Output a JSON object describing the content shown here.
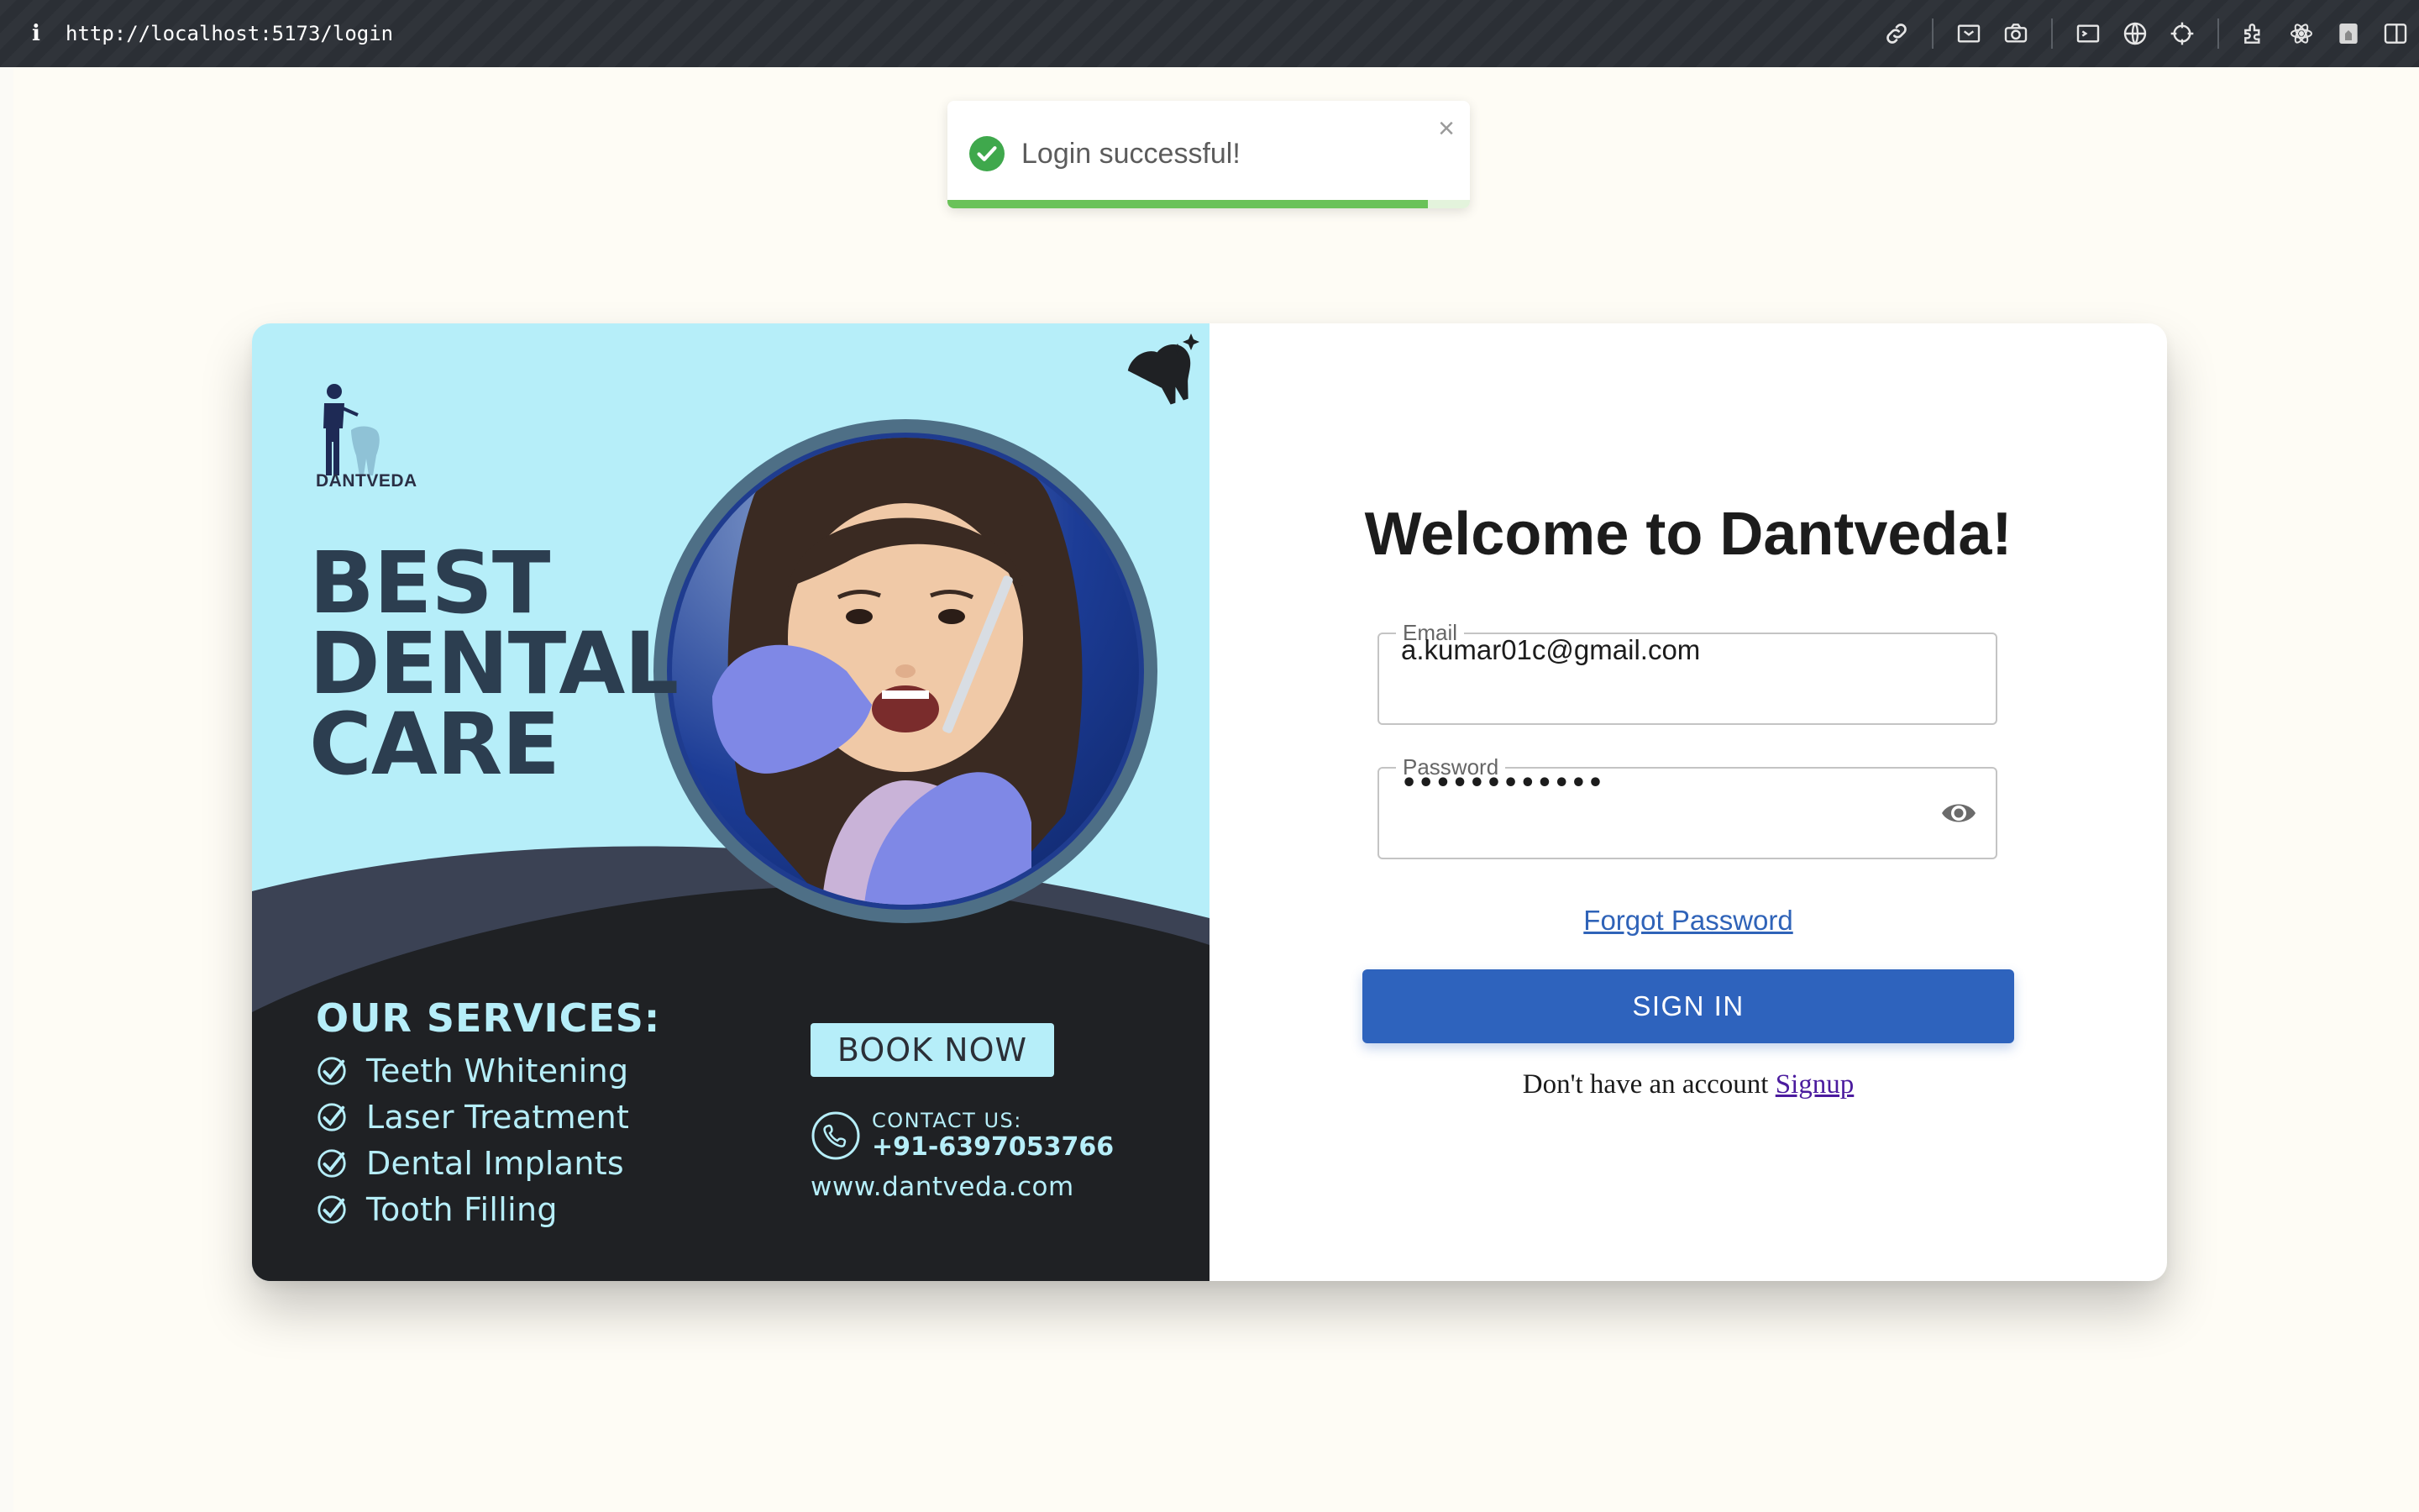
{
  "browser": {
    "info_glyph": "i",
    "url": "http://localhost:5173/login",
    "icons": [
      "link-icon",
      "screenshot-icon",
      "camera-icon",
      "terminal-icon",
      "globe-icon",
      "crosshair-icon",
      "extensions-icon",
      "react-icon",
      "profile-icon",
      "sidebar-icon"
    ]
  },
  "toast": {
    "message": "Login successful!",
    "close": "×",
    "progress": 0.92,
    "color": "#6ac259"
  },
  "promo": {
    "brand": "DANTVEDA",
    "headline": [
      "BEST",
      "DENTAL",
      "CARE"
    ],
    "services_title": "OUR SERVICES:",
    "services": [
      "Teeth Whitening",
      "Laser Treatment",
      "Dental Implants",
      "Tooth Filling"
    ],
    "book_button": "BOOK NOW",
    "contact_label": "CONTACT US:",
    "contact_phone": "+91-6397053766",
    "website": "www.dantveda.com",
    "colors": {
      "background": "#b6eef9",
      "dark": "#1f2124",
      "band": "#3b4254",
      "text": "#2c3e50"
    }
  },
  "login": {
    "title": "Welcome to Dantveda!",
    "email_label": "Email",
    "email_value": "a.kumar01c@gmail.com",
    "password_label": "Password",
    "password_value": "••••••••••••",
    "forgot_password": "Forgot Password",
    "signin_button": "SIGN IN",
    "signup_prompt": "Don't have an account",
    "signup_link": "Signup",
    "accent": "#2e63bd"
  }
}
